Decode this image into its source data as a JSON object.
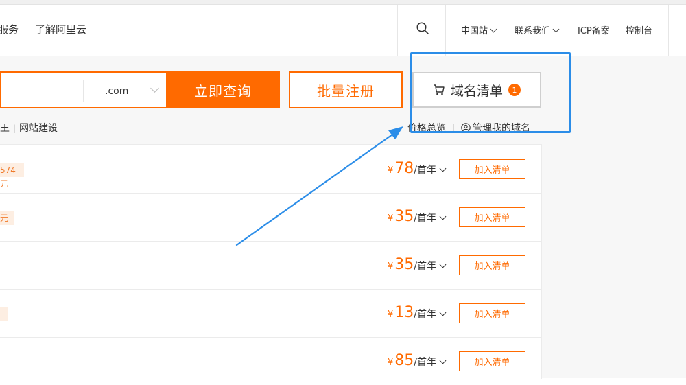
{
  "header": {
    "nav_left": [
      "服务",
      "了解阿里云"
    ],
    "menus": [
      {
        "label": "中国站",
        "dropdown": true
      },
      {
        "label": "联系我们",
        "dropdown": true
      },
      {
        "label": "ICP备案",
        "dropdown": false
      },
      {
        "label": "控制台",
        "dropdown": false
      }
    ],
    "search_icon": "search-icon"
  },
  "search": {
    "suffix": ".com",
    "query_label": "立即查询",
    "batch_label": "批量注册",
    "cart_label": "域名清单",
    "cart_count": "1"
  },
  "sub_links": [
    "王",
    "网站建设"
  ],
  "right_links": {
    "price_overview": "价格总览",
    "manage": "管理我的域名"
  },
  "rows": [
    {
      "tag": "574元",
      "currency": "¥",
      "price": "78",
      "unit": "/首年",
      "add_label": "加入清单"
    },
    {
      "tag": "元",
      "currency": "¥",
      "price": "35",
      "unit": "/首年",
      "add_label": "加入清单"
    },
    {
      "tag": "",
      "currency": "¥",
      "price": "35",
      "unit": "/首年",
      "add_label": "加入清单"
    },
    {
      "tag": "",
      "currency": "¥",
      "price": "13",
      "unit": "/首年",
      "add_label": "加入清单"
    },
    {
      "tag": "",
      "currency": "¥",
      "price": "85",
      "unit": "/首年",
      "add_label": "加入清单"
    }
  ],
  "colors": {
    "accent": "#ff6a00",
    "highlight": "#2b8de8"
  }
}
